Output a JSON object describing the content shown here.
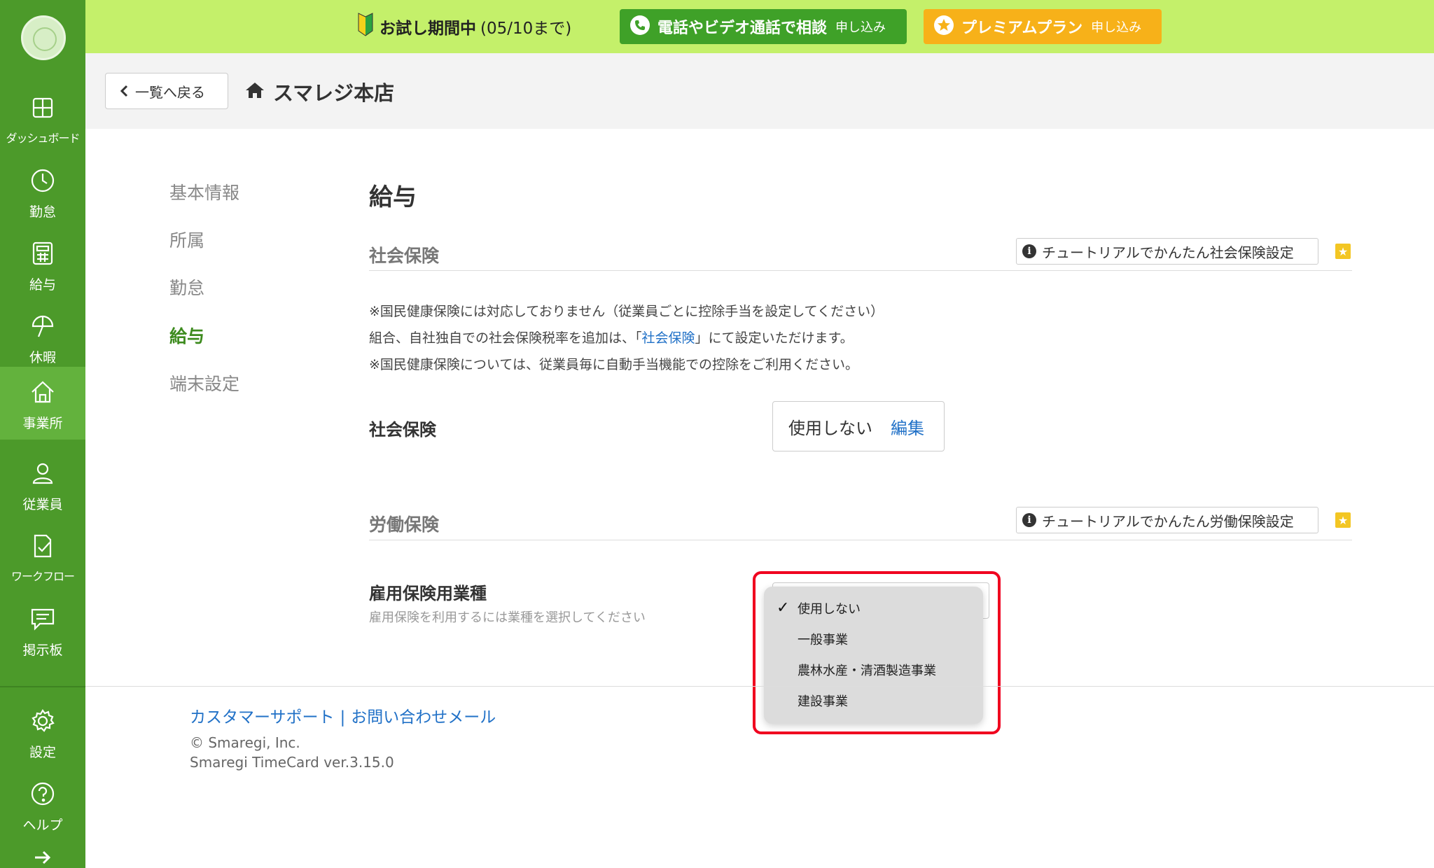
{
  "banner": {
    "trial_label": "お試し期間中",
    "trial_date": "(05/10まで)",
    "call_label": "電話やビデオ通話で相談",
    "call_sub": "申し込み",
    "premium_label": "プレミアムプラン",
    "premium_sub": "申し込み"
  },
  "sidebar": {
    "items": [
      {
        "label": "ダッシュボード",
        "icon": "dashboard-icon"
      },
      {
        "label": "勤怠",
        "icon": "clock-icon"
      },
      {
        "label": "給与",
        "icon": "calculator-icon"
      },
      {
        "label": "休暇",
        "icon": "umbrella-icon"
      },
      {
        "label": "事業所",
        "icon": "home-icon"
      },
      {
        "label": "従業員",
        "icon": "person-icon"
      },
      {
        "label": "ワークフロー",
        "icon": "workflow-icon"
      },
      {
        "label": "掲示板",
        "icon": "chat-icon"
      },
      {
        "label": "設定",
        "icon": "gear-icon"
      },
      {
        "label": "ヘルプ",
        "icon": "help-icon"
      }
    ],
    "active": "事業所"
  },
  "header": {
    "back_label": "一覧へ戻る",
    "store_name": "スマレジ本店"
  },
  "menu": {
    "items": [
      "基本情報",
      "所属",
      "勤怠",
      "給与",
      "端末設定"
    ],
    "active": "給与"
  },
  "main": {
    "title": "給与",
    "social": {
      "section_title": "社会保険",
      "tutorial_label": "チュートリアルでかんたん社会保険設定",
      "note1": "※国民健康保険には対応しておりません（従業員ごとに控除手当を設定してください）",
      "note2_prefix": "組合、自社独自での社会保険税率を追加は、「",
      "note2_link": "社会保険",
      "note2_suffix": "」にて設定いただけます。",
      "note3": "※国民健康保険については、従業員毎に自動手当機能での控除をご利用ください。",
      "field_label": "社会保険",
      "field_value": "使用しない",
      "edit_label": "編集"
    },
    "labor": {
      "section_title": "労働保険",
      "tutorial_label": "チュートリアルでかんたん労働保険設定",
      "field_label": "雇用保険用業種",
      "field_help": "雇用保険を利用するには業種を選択してください",
      "options": [
        "使用しない",
        "一般事業",
        "農林水産・清酒製造事業",
        "建設事業"
      ],
      "selected": "使用しない"
    }
  },
  "footer": {
    "support_link": "カスタマーサポート",
    "separator": "|",
    "mail_link": "お問い合わせメール",
    "copyright": "© Smaregi, Inc.",
    "version": "Smaregi TimeCard ver.3.15.0"
  },
  "colors": {
    "sidebar": "#4c9a2a",
    "sidebar_active": "#63b23d",
    "banner": "#c4f06a",
    "call_button": "#3fa128",
    "premium_button": "#f7b119",
    "link": "#2171c7",
    "highlight": "#f0001f"
  }
}
